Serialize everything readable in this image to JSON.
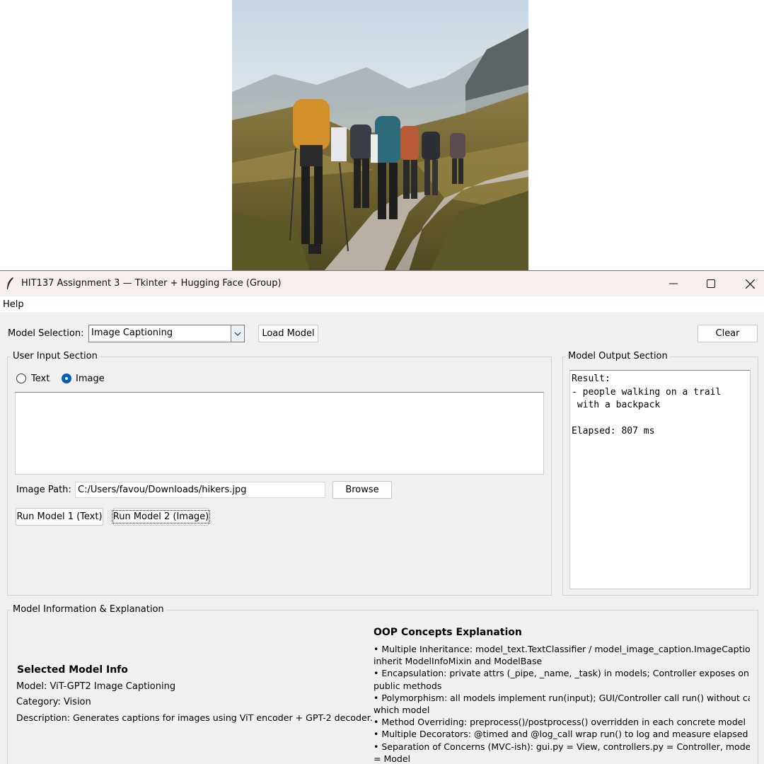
{
  "window": {
    "title": "HIT137 Assignment 3 — Tkinter + Hugging Face (Group)",
    "minimize_icon": "minimize-icon",
    "maximize_icon": "maximize-icon",
    "close_icon": "close-icon"
  },
  "menu": {
    "help": "Help"
  },
  "toolbar": {
    "model_selection_label": "Model Selection:",
    "model_selected": "Image Captioning",
    "load_model": "Load Model",
    "clear": "Clear"
  },
  "input_section": {
    "title": "User Input Section",
    "radio_text": "Text",
    "radio_image": "Image",
    "selected_mode": "Image",
    "image_path_label": "Image Path:",
    "image_path_value": "C:/Users/favou/Downloads/hikers.jpg",
    "browse": "Browse",
    "run_text": "Run Model 1 (Text)",
    "run_image": "Run Model 2 (Image)"
  },
  "output_section": {
    "title": "Model Output Section",
    "text": "Result:\n- people walking on a trail\n with a backpack\n\nElapsed: 807 ms"
  },
  "info_section": {
    "title": "Model Information & Explanation",
    "selected_heading": "Selected Model Info",
    "model_line": "Model: ViT-GPT2 Image Captioning",
    "category_line": "Category: Vision",
    "description_line": "Description: Generates captions for images using ViT encoder + GPT-2 decoder.",
    "oop_heading": "OOP Concepts Explanation",
    "oop_lines": [
      "• Multiple Inheritance: model_text.TextClassifier / model_image_caption.ImageCaption",
      "inherit ModelInfoMixin and ModelBase",
      "• Encapsulation: private attrs (_pipe, _name, _task) in models; Controller exposes only",
      "public methods",
      "• Polymorphism: all models implement run(input); GUI/Controller call run() without ca",
      "which model",
      "• Method Overriding: preprocess()/postprocess() overridden in each concrete model",
      "• Multiple Decorators: @timed and @log_call wrap run() to log and measure elapsed m",
      "• Separation of Concerns (MVC-ish): gui.py = View, controllers.py = Controller, model_",
      "= Model"
    ]
  }
}
